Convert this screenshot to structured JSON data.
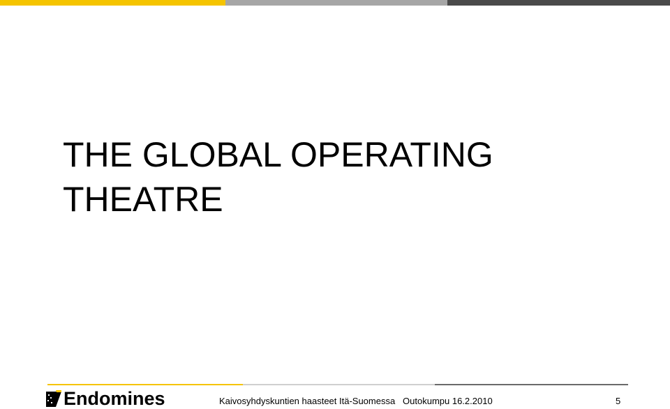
{
  "slide": {
    "title_line1": "THE GLOBAL OPERATING",
    "title_line2": "THEATRE"
  },
  "footer": {
    "logo_text": "Endomines",
    "caption": "Kaivosyhdyskuntien haasteet Itä-Suomessa   Outokumpu 16.2.2010",
    "page_number": "5"
  },
  "colors": {
    "accent_yellow": "#f5c400",
    "accent_light_gray": "#a6a6a6",
    "accent_dark_gray": "#4a4a4a",
    "text": "#000000"
  }
}
